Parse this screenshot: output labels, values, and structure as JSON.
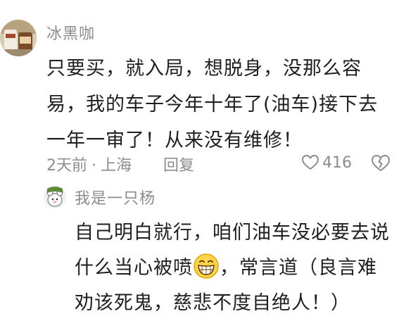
{
  "main_comment": {
    "username": "冰黑咖",
    "text": "只要买，就入局，想脱身，没那么容易，我的车子今年十年了(油车)接下去一年一审了！从来没有维修！",
    "time": "2天前",
    "location": "上海",
    "separator": "·",
    "reply_label": "回复",
    "like_count": "416",
    "avatar_icon": "avatar-photo-icon",
    "like_icon": "heart-outline-icon",
    "dislike_icon": "broken-heart-icon"
  },
  "reply_comment": {
    "username": "我是一只杨",
    "text_before_emoji": "自己明白就行，咱们油车没必要去说什么当心被喷",
    "text_after_emoji": "，常言道（良言难劝该死鬼，慈悲不度自绝人！）",
    "avatar_icon": "avatar-cartoon-icon",
    "emoji_icon": "grinning-face-emoji-icon"
  },
  "colors": {
    "text_primary": "#1f1f1f",
    "text_secondary": "#8c8c8c",
    "background": "#ffffff"
  }
}
